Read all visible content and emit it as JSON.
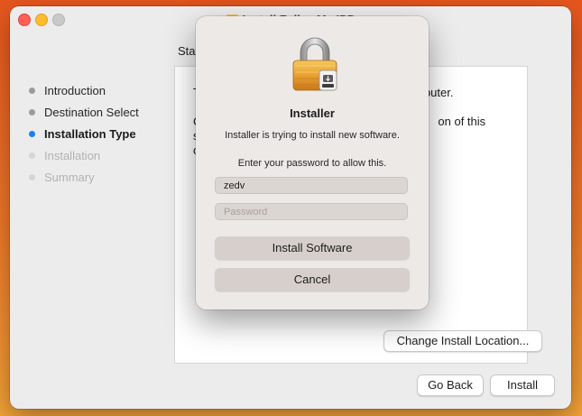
{
  "window": {
    "title": "Install FollowMe IPP"
  },
  "sidebar": {
    "steps": [
      {
        "label": "Introduction",
        "state": "done"
      },
      {
        "label": "Destination Select",
        "state": "done"
      },
      {
        "label": "Installation Type",
        "state": "current"
      },
      {
        "label": "Installation",
        "state": "future"
      },
      {
        "label": "Summary",
        "state": "future"
      }
    ]
  },
  "pane": {
    "heading": "Sta",
    "line1_start": "T",
    "line1_end": "puter.",
    "line2_start": "C",
    "line2_end": "on of this software",
    "line3_start": "o"
  },
  "buttons": {
    "change_location": "Change Install Location...",
    "go_back": "Go Back",
    "install": "Install"
  },
  "dialog": {
    "title": "Installer",
    "message": "Installer is trying to install new software.",
    "prompt": "Enter your password to allow this.",
    "username_value": "zedv",
    "password_placeholder": "Password",
    "install_button": "Install Software",
    "cancel_button": "Cancel",
    "icon": "lock-icon"
  },
  "colors": {
    "accent": "#1f7cf5",
    "close": "#fe5f57",
    "minimize": "#febc2e",
    "zoom_disabled": "#c9c9c9"
  }
}
